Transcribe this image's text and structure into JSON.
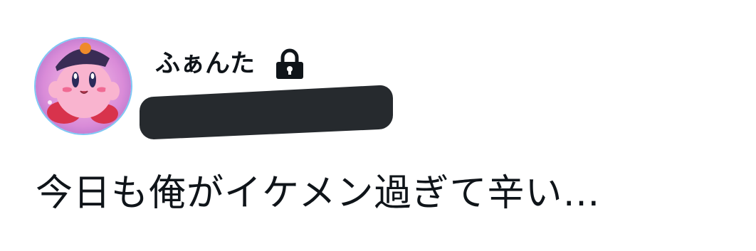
{
  "tweet": {
    "display_name": "ふぁんた",
    "protected_icon": "lock-icon",
    "avatar_icon": "kirby-avatar-image",
    "handle_redacted": true,
    "text": "今日も俺がイケメン過ぎて辛い…"
  },
  "colors": {
    "text": "#0f1419",
    "redaction": "#262a2e",
    "avatar_border": "#7ec8f5"
  }
}
